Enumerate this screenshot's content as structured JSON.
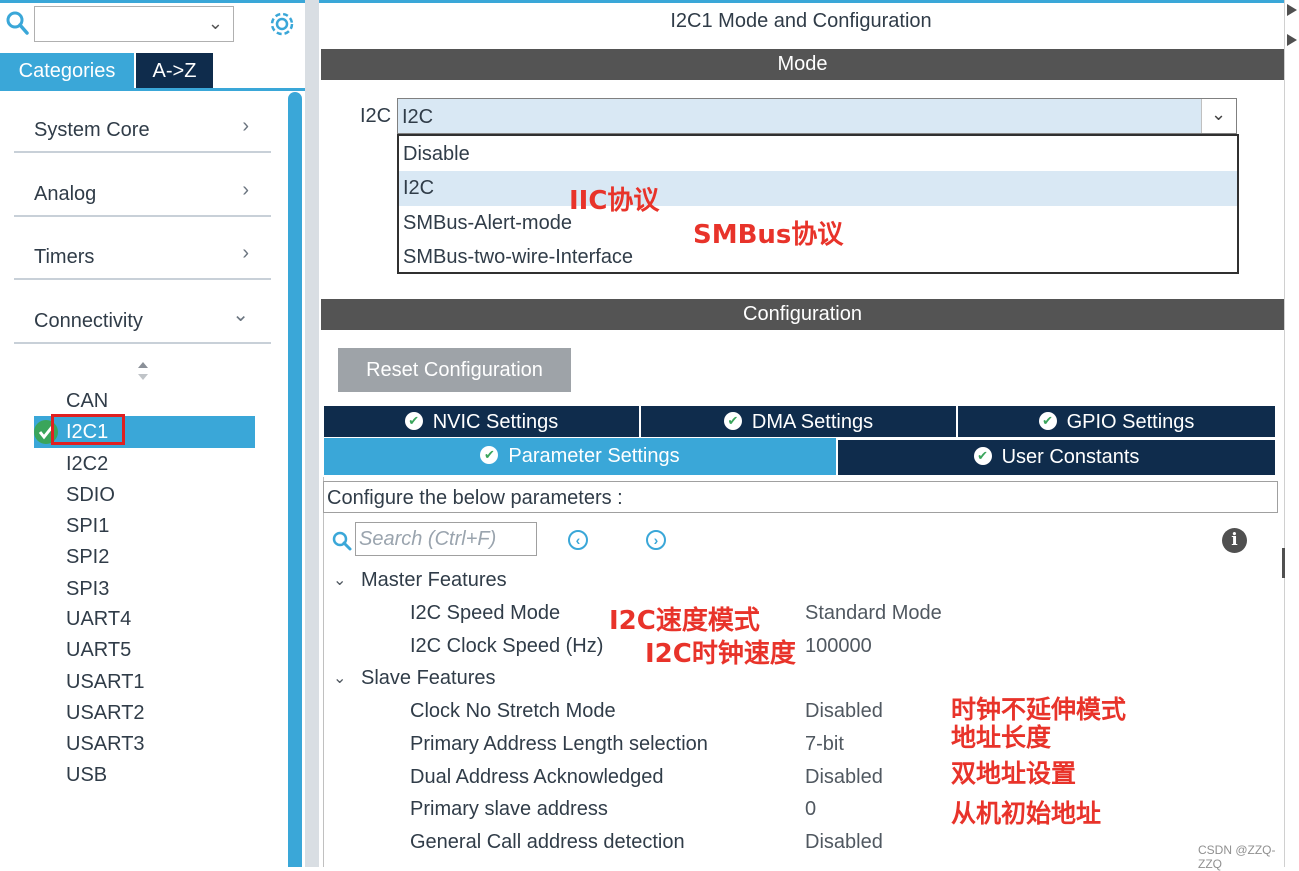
{
  "left": {
    "search_dropdown_value": "",
    "tabs": {
      "categories": "Categories",
      "az": "A->Z"
    },
    "categories": [
      {
        "label": "System Core"
      },
      {
        "label": "Analog"
      },
      {
        "label": "Timers"
      },
      {
        "label": "Connectivity"
      }
    ],
    "peripherals": [
      "CAN",
      "I2C1",
      "I2C2",
      "SDIO",
      "SPI1",
      "SPI2",
      "SPI3",
      "UART4",
      "UART5",
      "USART1",
      "USART2",
      "USART3",
      "USB"
    ]
  },
  "window": {
    "title": "I2C1 Mode and Configuration"
  },
  "mode": {
    "header": "Mode",
    "field_label": "I2C",
    "selected": "I2C",
    "options": [
      "Disable",
      "I2C",
      "SMBus-Alert-mode",
      "SMBus-two-wire-Interface"
    ]
  },
  "annotations": {
    "iic": "IIC协议",
    "smbus": "SMBus协议",
    "speed_mode": "I2C速度模式",
    "clock_speed": "I2C时钟速度",
    "no_stretch": "时钟不延伸模式",
    "addr_len": "地址长度",
    "dual_addr": "双地址设置",
    "slave_addr": "从机初始地址"
  },
  "config": {
    "header": "Configuration",
    "reset_button": "Reset Configuration",
    "tabs_row1": [
      "NVIC Settings",
      "DMA Settings",
      "GPIO Settings"
    ],
    "tabs_row2": [
      "Parameter Settings",
      "User Constants"
    ],
    "description": "Configure the below parameters :",
    "search_placeholder": "Search (Ctrl+F)",
    "groups": {
      "master": {
        "title": "Master Features",
        "params": [
          {
            "name": "I2C Speed Mode",
            "value": "Standard Mode"
          },
          {
            "name": "I2C Clock Speed (Hz)",
            "value": "100000"
          }
        ]
      },
      "slave": {
        "title": "Slave Features",
        "params": [
          {
            "name": "Clock No Stretch Mode",
            "value": "Disabled"
          },
          {
            "name": "Primary Address Length selection",
            "value": "7-bit"
          },
          {
            "name": "Dual Address Acknowledged",
            "value": "Disabled"
          },
          {
            "name": "Primary slave address",
            "value": "0"
          },
          {
            "name": "General Call address detection",
            "value": "Disabled"
          }
        ]
      }
    }
  },
  "watermark": "CSDN @ZZQ-ZZQ",
  "colors": {
    "accent": "#3aa7d8",
    "dark_tab": "#0f2c4c",
    "section_bar": "#545454",
    "annotation": "#e8332a",
    "check_green": "#3aa55b"
  }
}
